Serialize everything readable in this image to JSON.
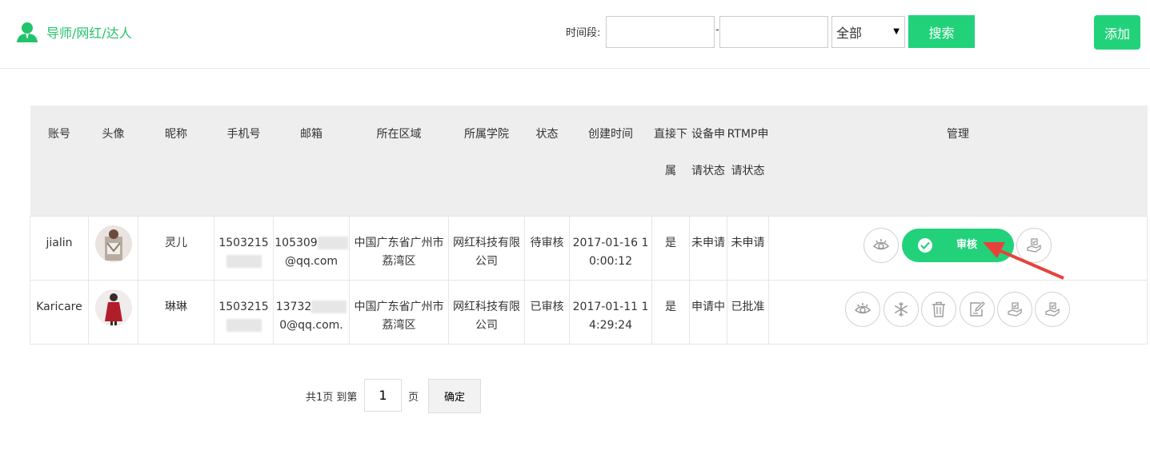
{
  "header": {
    "title": "导师/网红/达人",
    "time_label": "时间段:",
    "date_separator": "-",
    "date_start": "",
    "date_end": "",
    "status_selected": "全部",
    "search_label": "搜索",
    "add_label": "添加"
  },
  "table": {
    "columns": [
      "账号",
      "头像",
      "昵称",
      "手机号",
      "邮箱",
      "所在区域",
      "所属学院",
      "状态",
      "创建时间",
      "直接下属",
      "设备申请状态",
      "RTMP申请状态",
      "管理"
    ],
    "rows": [
      {
        "account": "jialin",
        "nickname": "灵儿",
        "phone": "1503215",
        "email_prefix": "105309",
        "email_suffix": "@qq.com",
        "region": "中国广东省广州市荔湾区",
        "college": "网红科技有限公司",
        "status": "待审核",
        "created": "2017-01-16 10:00:12",
        "direct": "是",
        "device_status": "未申请",
        "rtmp_status": "未申请",
        "review_label": "审核"
      },
      {
        "account": "Karicare",
        "nickname": "琳琳",
        "phone": "1503215",
        "email_prefix": "13732",
        "email_suffix": "0@qq.com.",
        "region": "中国广东省广州市荔湾区",
        "college": "网红科技有限公司",
        "status": "已审核",
        "created": "2017-01-11 14:29:24",
        "direct": "是",
        "device_status": "申请中",
        "rtmp_status": "已批准"
      }
    ]
  },
  "pager": {
    "text_prefix": "共1页 到第",
    "page_value": "1",
    "text_suffix": "页",
    "confirm_label": "确定"
  },
  "colors": {
    "accent": "#22d27a",
    "arrow": "#e8413c"
  },
  "icons": {
    "brand": "user-icon",
    "view": "eye-icon",
    "freeze": "snowflake-icon",
    "delete": "trash-icon",
    "edit": "edit-icon",
    "approve_a": "hand-check-icon",
    "approve_b": "hand-check-alt-icon"
  }
}
